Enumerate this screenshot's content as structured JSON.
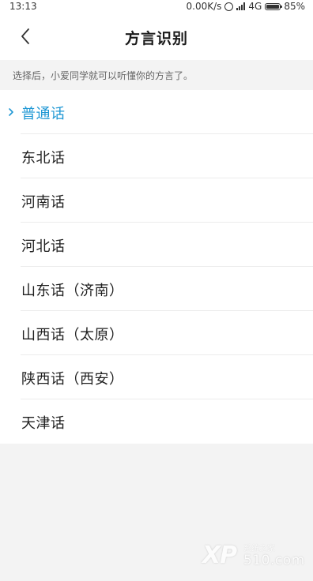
{
  "status_bar": {
    "time": "13:13",
    "speed": "0.00K/s",
    "network": "4G",
    "battery": "85%"
  },
  "header": {
    "back_icon": "chevron-left-icon",
    "title": "方言识别"
  },
  "hint": "选择后，小爱同学就可以听懂你的方言了。",
  "dialects": [
    {
      "label": "普通话",
      "selected": true
    },
    {
      "label": "东北话",
      "selected": false
    },
    {
      "label": "河南话",
      "selected": false
    },
    {
      "label": "河北话",
      "selected": false
    },
    {
      "label": "山东话（济南）",
      "selected": false
    },
    {
      "label": "山西话（太原）",
      "selected": false
    },
    {
      "label": "陕西话（西安）",
      "selected": false
    },
    {
      "label": "天津话",
      "selected": false
    }
  ],
  "colors": {
    "accent": "#1e97d4",
    "background": "#f3f3f3"
  },
  "watermark": {
    "logo": "XP",
    "site": "系统之家",
    "domain": "510.com"
  }
}
